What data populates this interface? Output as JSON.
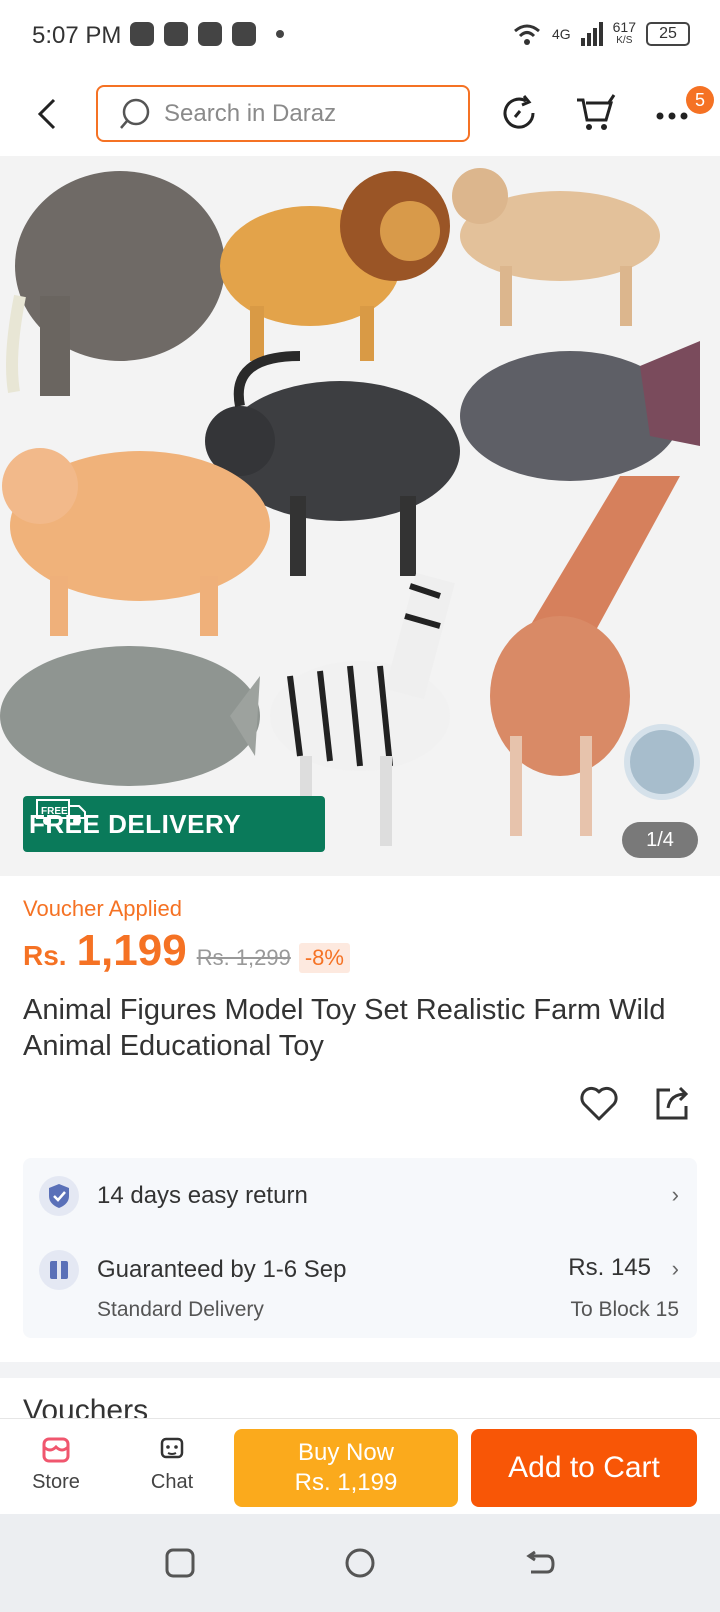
{
  "status_bar": {
    "time": "5:07 PM",
    "network": "4G",
    "speed": "617",
    "speed_unit": "K/S",
    "battery": "25"
  },
  "top_bar": {
    "search_placeholder": "Search in Daraz",
    "more_badge": "5"
  },
  "gallery": {
    "badge_text": "FREE DELIVERY",
    "badge_icon_text": "FREE",
    "counter": "1/4"
  },
  "product": {
    "voucher_label": "Voucher Applied",
    "currency": "Rs.",
    "price": "1,199",
    "original_price": "Rs. 1,299",
    "discount": "-8%",
    "title": "Animal Figures Model Toy Set Realistic Farm Wild Animal Educational Toy"
  },
  "delivery": {
    "return_text": "14 days easy return",
    "guarantee_text": "Guaranteed by 1-6 Sep",
    "delivery_type": "Standard Delivery",
    "fee": "Rs. 145",
    "destination": "To Block 15"
  },
  "peek_text": "Vouchers",
  "bottom_bar": {
    "store_label": "Store",
    "chat_label": "Chat",
    "buy_now_line1": "Buy Now",
    "buy_now_line2": "Rs. 1,199",
    "add_to_cart": "Add to Cart"
  },
  "colors": {
    "accent": "#f57224",
    "buy_now": "#fbaa1c",
    "add_to_cart": "#f85606",
    "free_delivery": "#0a7a5a"
  }
}
